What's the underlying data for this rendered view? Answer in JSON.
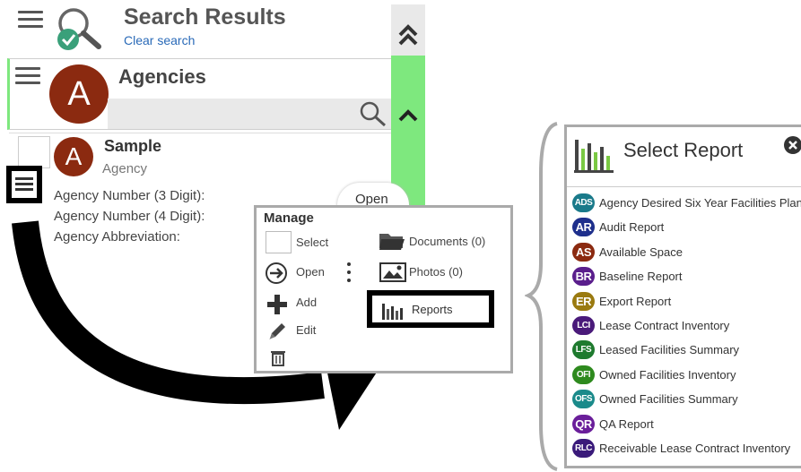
{
  "header": {
    "title": "Search Results",
    "clear_search": "Clear search"
  },
  "agencies": {
    "title": "Agencies",
    "avatar_letter": "A"
  },
  "record": {
    "avatar_letter": "A",
    "name": "Sample",
    "type": "Agency",
    "fields": [
      "Agency Number (3 Digit):",
      "Agency Number (4 Digit):",
      "Agency Abbreviation:"
    ],
    "open_label": "Open"
  },
  "manage": {
    "title": "Manage",
    "select": "Select",
    "open": "Open",
    "add": "Add",
    "edit": "Edit",
    "documents": "Documents (0)",
    "photos": "Photos (0)",
    "reports": "Reports"
  },
  "report_panel": {
    "title": "Select Report",
    "items": [
      {
        "badge": "ADS",
        "label": "Agency Desired Six Year Facilities Plan",
        "color": "#1a7a8a"
      },
      {
        "badge": "AR",
        "label": "Audit Report",
        "color": "#1e2f8c"
      },
      {
        "badge": "AS",
        "label": "Available Space",
        "color": "#8b2a10"
      },
      {
        "badge": "BR",
        "label": "Baseline Report",
        "color": "#5a1e8c"
      },
      {
        "badge": "ER",
        "label": "Export Report",
        "color": "#9a7a10"
      },
      {
        "badge": "LCI",
        "label": "Lease Contract Inventory",
        "color": "#4a1a7a"
      },
      {
        "badge": "LFS",
        "label": "Leased Facilities Summary",
        "color": "#1e7a2e"
      },
      {
        "badge": "OFI",
        "label": "Owned Facilities Inventory",
        "color": "#2e8a1e"
      },
      {
        "badge": "OFS",
        "label": "Owned Facilities Summary",
        "color": "#1a8a8a"
      },
      {
        "badge": "QR",
        "label": "QA Report",
        "color": "#6a1e9a"
      },
      {
        "badge": "RLC",
        "label": "Receivable Lease Contract Inventory",
        "color": "#3a1a7a"
      }
    ]
  },
  "colors": {
    "accent_green": "#7ee87e",
    "avatar_brown": "#8b2a10",
    "link_blue": "#2a6ab8",
    "check_teal": "#3aa07a"
  }
}
